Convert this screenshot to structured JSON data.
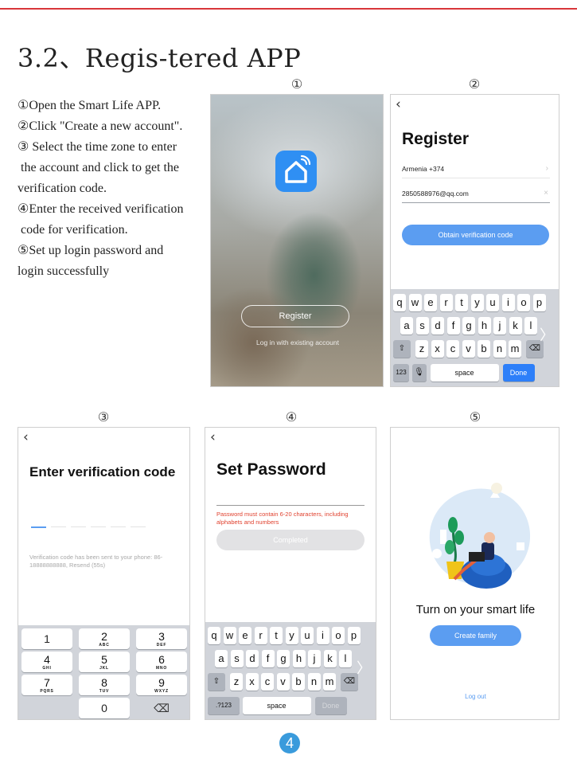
{
  "title": "3.2、Regis-tered APP",
  "steps": [
    "①Open the Smart Life APP.",
    "②Click \"Create a new account\".",
    "③ Select the time zone to enter",
    " the account and click to get the",
    "verification code.",
    "④Enter the received verification",
    " code for verification.",
    "⑤Set up login password and",
    "login successfully"
  ],
  "labels": [
    "①",
    "②",
    "③",
    "④",
    "⑤"
  ],
  "screen1": {
    "register_label": "Register",
    "login_link": "Log in with existing account",
    "icon": "smart-life-home-icon"
  },
  "screen2": {
    "back": "‹",
    "title": "Register",
    "country": "Armenia +374",
    "email": "2850588976@qq.com",
    "obtain_label": "Obtain verification code",
    "keyboard": {
      "row1": [
        "q",
        "w",
        "e",
        "r",
        "t",
        "y",
        "u",
        "i",
        "o",
        "p"
      ],
      "row2": [
        "a",
        "s",
        "d",
        "f",
        "g",
        "h",
        "j",
        "k",
        "l"
      ],
      "row3": [
        "z",
        "x",
        "c",
        "v",
        "b",
        "n",
        "m"
      ],
      "mode": "123",
      "space": "space",
      "done": "Done"
    }
  },
  "screen3": {
    "back": "‹",
    "title": "Enter verification code",
    "sent_text": "Verification code has been sent to your phone: 86-18888888888, Resend (55s)",
    "numpad": [
      {
        "d": "1",
        "l": ""
      },
      {
        "d": "2",
        "l": "ABC"
      },
      {
        "d": "3",
        "l": "DEF"
      },
      {
        "d": "4",
        "l": "GHI"
      },
      {
        "d": "5",
        "l": "JKL"
      },
      {
        "d": "6",
        "l": "MNO"
      },
      {
        "d": "7",
        "l": "PQRS"
      },
      {
        "d": "8",
        "l": "TUV"
      },
      {
        "d": "9",
        "l": "WXYZ"
      }
    ],
    "zero": "0"
  },
  "screen4": {
    "back": "‹",
    "title": "Set Password",
    "hint": "Password must contain 6-20 characters, including alphabets and numbers",
    "completed_label": "Completed",
    "keyboard": {
      "mode": ".?123",
      "space": "space",
      "done": "Done"
    }
  },
  "screen5": {
    "title": "Turn on your smart life",
    "create_label": "Create family",
    "logout_label": "Log out"
  },
  "page_number": "4",
  "colors": {
    "accent": "#5b9df1",
    "rule": "#d9363a",
    "badge": "#3a9bdc"
  }
}
